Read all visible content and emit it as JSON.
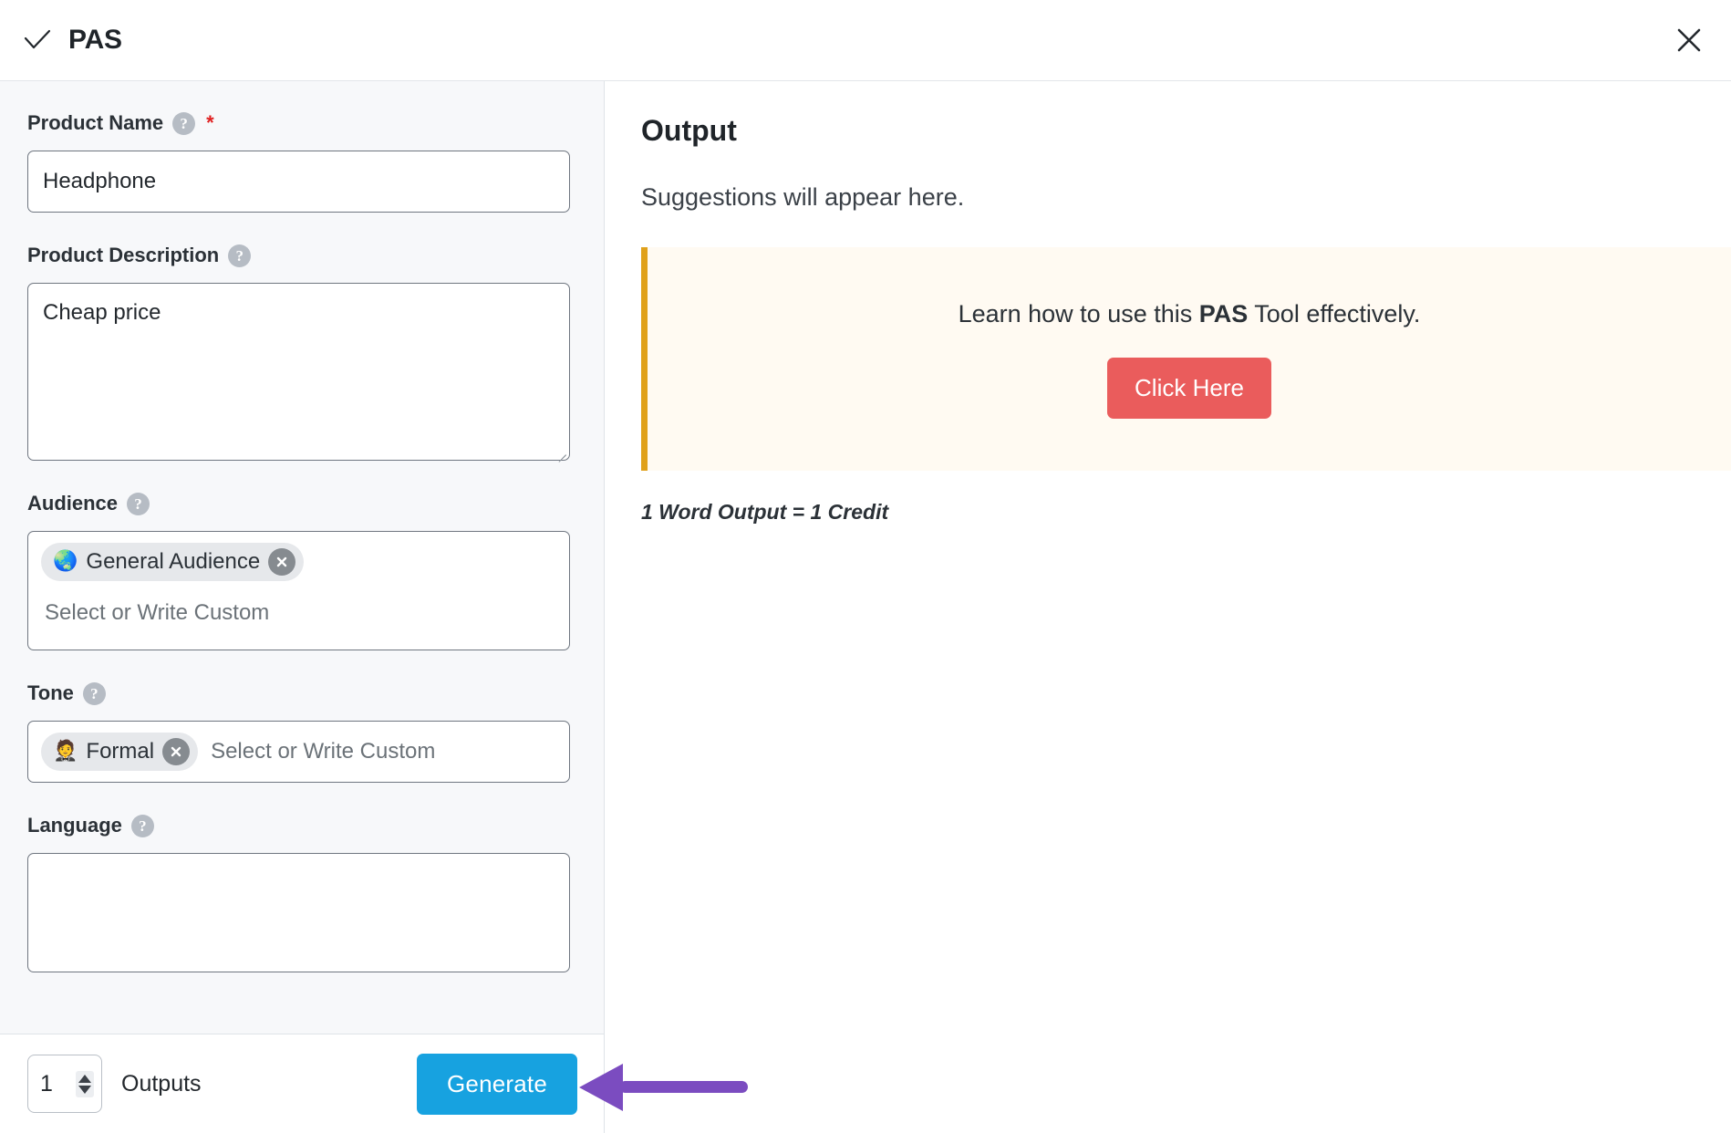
{
  "header": {
    "title": "PAS",
    "check_icon": "check-icon",
    "close_icon": "close-icon"
  },
  "form": {
    "product_name": {
      "label": "Product Name",
      "help_icon": "question-mark-icon",
      "required_marker": "*",
      "value": "Headphone",
      "placeholder": ""
    },
    "product_description": {
      "label": "Product Description",
      "help_icon": "question-mark-icon",
      "value": "Cheap price",
      "placeholder": ""
    },
    "audience": {
      "label": "Audience",
      "help_icon": "question-mark-icon",
      "placeholder": "Select or Write Custom",
      "chips": [
        {
          "emoji": "🌏",
          "label": "General Audience",
          "remove_icon": "close-icon"
        }
      ]
    },
    "tone": {
      "label": "Tone",
      "help_icon": "question-mark-icon",
      "placeholder": "Select or Write Custom",
      "chips": [
        {
          "emoji": "🤵",
          "label": "Formal",
          "remove_icon": "close-icon"
        }
      ]
    },
    "language": {
      "label": "Language",
      "help_icon": "question-mark-icon"
    }
  },
  "footer": {
    "outputs_value": "1",
    "outputs_label": "Outputs",
    "stepper_up_icon": "chevron-up-icon",
    "stepper_down_icon": "chevron-down-icon",
    "generate_label": "Generate",
    "generate_color": "#17a2e0"
  },
  "output": {
    "title": "Output",
    "subtitle": "Suggestions will appear here.",
    "banner": {
      "text_before": "Learn how to use this ",
      "text_bold": "PAS",
      "text_after": " Tool effectively.",
      "button_label": "Click Here",
      "button_color": "#ea5c5c",
      "accent_color": "#e0a11b",
      "background_color": "#fffaf2"
    },
    "credit_note": "1 Word Output = 1 Credit"
  },
  "annotation": {
    "arrow_icon": "left-arrow-icon",
    "color": "#7b4cc0"
  }
}
